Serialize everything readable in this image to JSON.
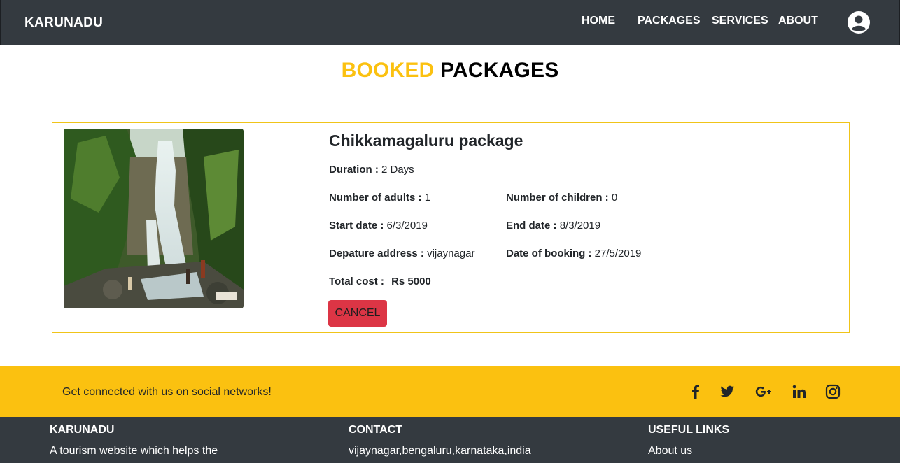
{
  "navbar": {
    "brand": "KARUNADU",
    "items": [
      "HOME",
      "PACKAGES",
      "SERVICES",
      "ABOUT"
    ]
  },
  "page_title": {
    "accent": "BOOKED",
    "main": "PACKAGES"
  },
  "booking": {
    "package_name": "Chikkamagaluru package",
    "duration_label": "Duration :",
    "duration_value": "2 Days",
    "adults_label": "Number of adults :",
    "adults_value": "1",
    "children_label": "Number of children :",
    "children_value": "0",
    "start_label": "Start date :",
    "start_value": "6/3/2019",
    "end_label": "End date :",
    "end_value": "8/3/2019",
    "departure_label": "Depature address :",
    "departure_value": "vijaynagar",
    "booking_date_label": "Date of booking :",
    "booking_date_value": "27/5/2019",
    "cost_label": "Total cost :",
    "cost_value": "Rs 5000",
    "cancel_label": "CANCEL"
  },
  "social": {
    "text": "Get connected with us on social networks!",
    "icons": [
      "facebook-icon",
      "twitter-icon",
      "google-plus-icon",
      "linkedin-icon",
      "instagram-icon"
    ]
  },
  "footer": {
    "col1_heading": "KARUNADU",
    "col1_text": "A tourism website which helps the",
    "col2_heading": "CONTACT",
    "col2_text": "vijaynagar,bengaluru,karnataka,india",
    "col3_heading": "USEFUL LINKS",
    "col3_text": "About us"
  },
  "colors": {
    "navbar": "#343a40",
    "accent": "#fbc110",
    "danger": "#dc3545"
  }
}
